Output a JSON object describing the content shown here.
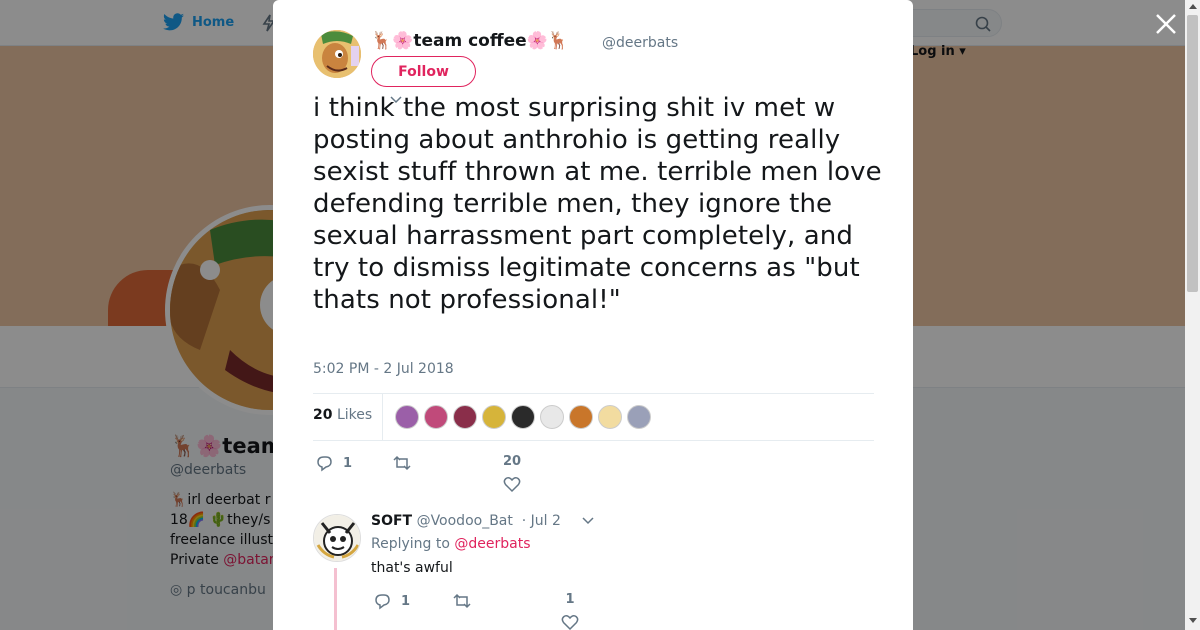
{
  "background": {
    "nav": {
      "home_label": "Home",
      "login_label": "Log in"
    },
    "profile": {
      "name": "🦌🌸team coffee🌸🦌",
      "handle": "@deerbats",
      "bio_line1": "🦌irl deerbat r",
      "bio_line2": "18🌈 🌵they/s",
      "bio_line3": "freelance illust",
      "bio_line4_prefix": "Private ",
      "bio_line4_link": "@batar",
      "location": "p toucanbu"
    }
  },
  "modal": {
    "close_label": "✕",
    "author": {
      "name": "🦌🌸team coffee🌸🦌",
      "handle": "@deerbats",
      "follow_label": "Follow"
    },
    "tweet_text": "i think the most surprising shit iv met w posting about anthrohio is getting really sexist stuff thrown at me. terrible men love defending terrible men, they ignore the sexual harrassment part completely, and try to dismiss legitimate concerns as \"but thats not professional!\"",
    "timestamp": "5:02 PM - 2 Jul 2018",
    "likes_count": "20",
    "likes_label": "Likes",
    "liker_colors": [
      "#9b5fa8",
      "#c04a7a",
      "#8a2e4a",
      "#d6b43a",
      "#2a2a2a",
      "#e8e8e8",
      "#c9762a",
      "#f2dca0",
      "#9aa0b8"
    ],
    "actions": {
      "replies": "1",
      "retweets": "",
      "likes": "20"
    },
    "reply": {
      "name": "SOFT",
      "handle": "@Voodoo_Bat",
      "date": "· Jul 2",
      "replying_prefix": "Replying to ",
      "replying_to": "@deerbats",
      "text": "that's awful",
      "replies": "1",
      "likes": "1"
    }
  },
  "colors": {
    "accent": "#e0245e",
    "twitter_blue": "#1da1f2",
    "muted": "#657786"
  }
}
